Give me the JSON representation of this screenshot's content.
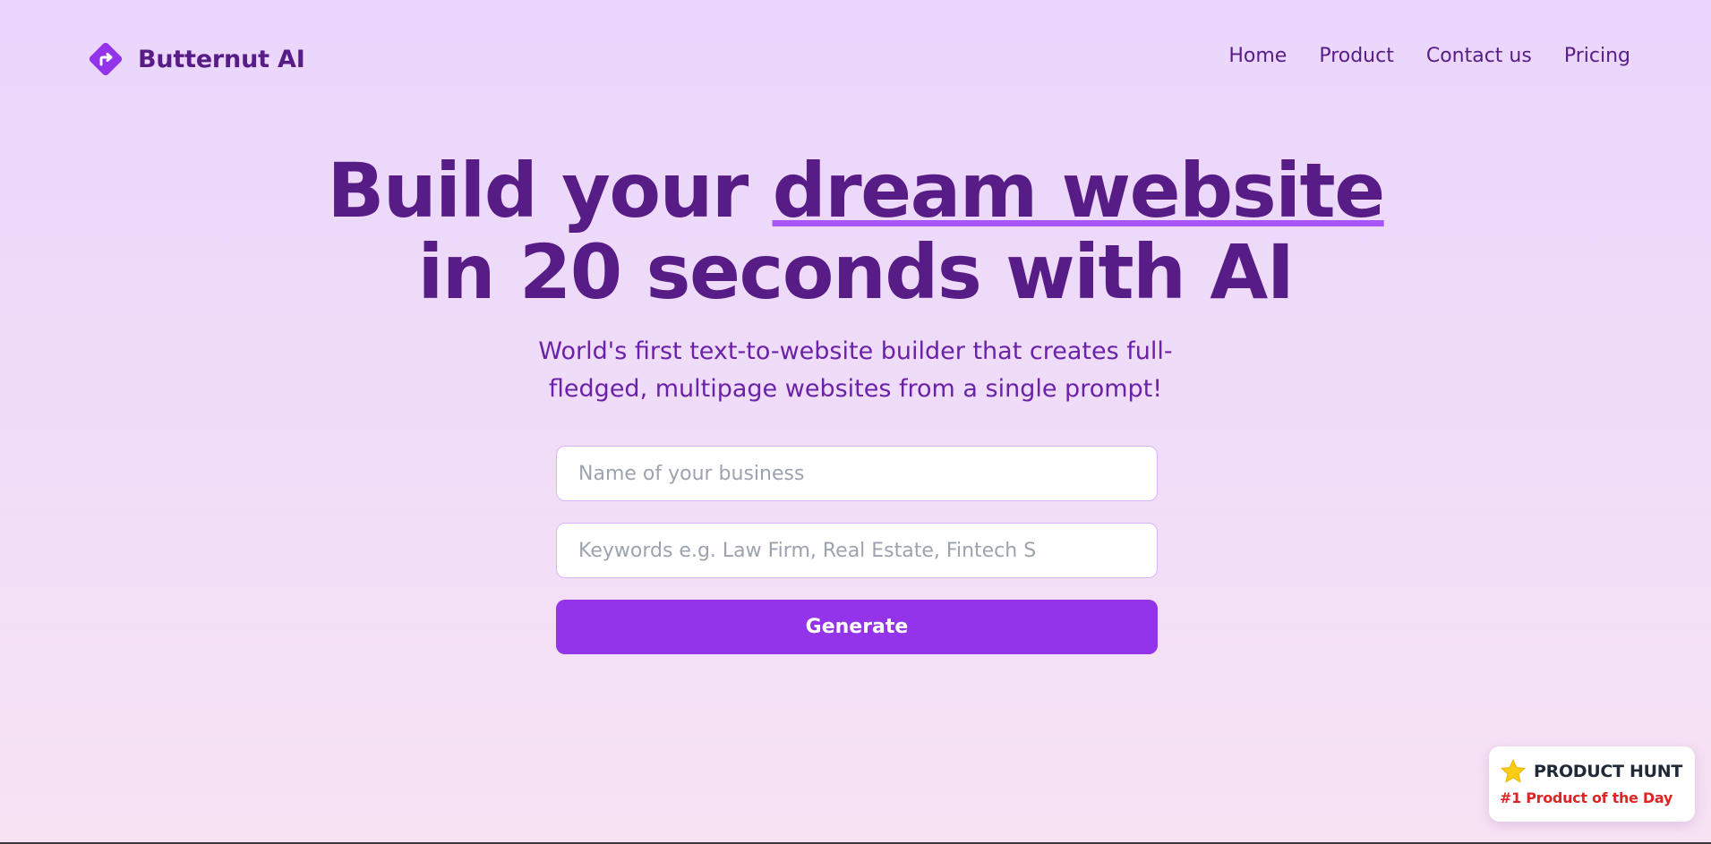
{
  "brand": {
    "name": "Butternut AI",
    "logo_icon": "diamond-turn-right-icon",
    "accent": "#9333ea"
  },
  "nav": {
    "items": [
      {
        "label": "Home"
      },
      {
        "label": "Product"
      },
      {
        "label": "Contact us"
      },
      {
        "label": "Pricing"
      }
    ]
  },
  "hero": {
    "headline_part1": "Build your ",
    "headline_highlight": "dream website",
    "headline_line2": "in 20 seconds with AI",
    "subheadline": "World's first text-to-website builder that creates full-fledged, multipage websites from a single prompt!"
  },
  "form": {
    "business_name": {
      "value": "",
      "placeholder": "Name of your business"
    },
    "keywords": {
      "value": "",
      "placeholder": "Keywords e.g. Law Firm, Real Estate, Fintech S"
    },
    "submit_label": "Generate"
  },
  "product_hunt_badge": {
    "icon": "star-icon",
    "title": "PRODUCT HUNT",
    "subtitle": "#1 Product of the Day"
  },
  "colors": {
    "text_dark_purple": "#581c87",
    "button_purple": "#9333ea",
    "underline_purple": "#a855f7",
    "badge_red": "#dc2626"
  }
}
